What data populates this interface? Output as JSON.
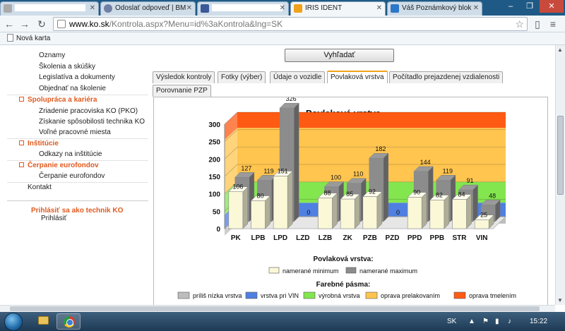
{
  "browser": {
    "tabs": [
      {
        "title": "",
        "redacted": true
      },
      {
        "title": "Odoslať odpoveď | BM",
        "redacted": false
      },
      {
        "title": "",
        "redacted": true
      },
      {
        "title": "IRIS IDENT",
        "redacted": false
      },
      {
        "title": "Váš Poznámkový blok",
        "redacted": false
      }
    ],
    "url_host": "www.ko.sk",
    "url_path": "/Kontrola.aspx?Menu=id%3aKontrola&lng=SK",
    "bookmark": "Nová karta"
  },
  "sidebar": {
    "items": [
      {
        "label": "Oznamy",
        "type": "sub"
      },
      {
        "label": "Školenia a skúšky",
        "type": "sub"
      },
      {
        "label": "Legislatíva a dokumenty",
        "type": "sub"
      },
      {
        "label": "Objednať na školenie",
        "type": "sub"
      },
      {
        "label": "Spolupráca a kariéra",
        "type": "head"
      },
      {
        "label": "Zriadenie pracoviska KO (PKO)",
        "type": "sub"
      },
      {
        "label": "Získanie spôsobilosti technika KO",
        "type": "sub"
      },
      {
        "label": "Voľné pracovné miesta",
        "type": "sub"
      },
      {
        "label": "Inštitúcie",
        "type": "head"
      },
      {
        "label": "Odkazy na inštitúcie",
        "type": "sub"
      },
      {
        "label": "Čerpanie eurofondov",
        "type": "head"
      },
      {
        "label": "Čerpanie eurofondov",
        "type": "sub"
      },
      {
        "label": "Kontakt",
        "type": "top"
      }
    ],
    "login_title": "Prihlásiť sa ako technik KO",
    "login_link": "Prihlásiť"
  },
  "search_button": "Vyhľadať",
  "content_tabs": [
    {
      "label": "Výsledok kontroly",
      "active": false
    },
    {
      "label": "Fotky (výber)",
      "active": false
    },
    {
      "label": "Údaje o vozidle",
      "active": false
    },
    {
      "label": "Povlaková vrstva",
      "active": true
    },
    {
      "label": "Počítadlo prejazdenej vzdialenosti",
      "active": false
    },
    {
      "label": "Porovnanie PZP",
      "active": false
    }
  ],
  "chart_data": {
    "type": "bar",
    "title": "Povlaková vrstva",
    "categories": [
      "PK",
      "LPB",
      "LPD",
      "LZD",
      "LZB",
      "ZK",
      "PZB",
      "PZD",
      "PPD",
      "PPB",
      "STR",
      "VIN"
    ],
    "series": [
      {
        "name": "namerané minimum",
        "color": "#fbf8d8",
        "values": [
          106,
          80,
          151,
          0,
          88,
          85,
          92,
          0,
          90,
          82,
          84,
          25
        ]
      },
      {
        "name": "namerané maximum",
        "color": "#8c8c8c",
        "values": [
          127,
          119,
          326,
          0,
          100,
          110,
          182,
          0,
          144,
          119,
          91,
          48
        ]
      }
    ],
    "ylim": [
      0,
      300
    ],
    "yticks": [
      0,
      50,
      100,
      150,
      200,
      250,
      300
    ],
    "legend_title": "Povlaková vrstva:",
    "bands_title": "Farebné pásma:",
    "bands": [
      {
        "label": "príliš nízka vrstva",
        "color": "#bdbdbd"
      },
      {
        "label": "vrstva pri VIN",
        "color": "#4f7fe0"
      },
      {
        "label": "výrobná vrstva",
        "color": "#83e64f"
      },
      {
        "label": "oprava prelakovaním",
        "color": "#ffc54f"
      },
      {
        "label": "oprava tmelením",
        "color": "#ff5a14"
      }
    ]
  },
  "taskbar": {
    "lang": "SK",
    "time": "15:22"
  }
}
